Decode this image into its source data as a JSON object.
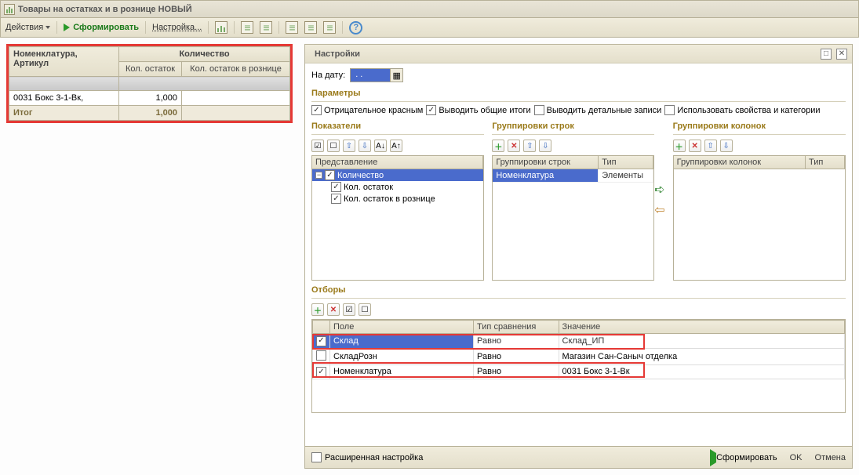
{
  "window": {
    "title": "Товары на остатках и в рознице НОВЫЙ"
  },
  "toolbar": {
    "actions": "Действия",
    "generate": "Сформировать",
    "settings": "Настройка..."
  },
  "grid": {
    "header_nomenclature": "Номенклатура, Артикул",
    "header_qty": "Количество",
    "header_balance": "Кол. остаток",
    "header_retail": "Кол. остаток в рознице",
    "rows": [
      {
        "name": "0031 Бокс 3-1-Вк,",
        "balance": "1,000"
      }
    ],
    "total_label": "Итог",
    "total_balance": "1,000"
  },
  "settings": {
    "title": "Настройки",
    "date_label": "На дату:",
    "params_label": "Параметры",
    "checks": {
      "neg_red": "Отрицательное красным",
      "totals": "Выводить общие итоги",
      "details": "Выводить детальные записи",
      "props": "Использовать свойства и категории"
    },
    "indicators": {
      "label": "Показатели",
      "col": "Представление",
      "items": [
        "Количество",
        "Кол. остаток",
        "Кол. остаток в рознице"
      ]
    },
    "row_groups": {
      "label": "Группировки строк",
      "col": "Группировки строк",
      "col2": "Тип",
      "item": "Номенклатура",
      "type": "Элементы"
    },
    "col_groups": {
      "label": "Группировки колонок",
      "col": "Группировки колонок",
      "col2": "Тип"
    },
    "filters": {
      "label": "Отборы",
      "col_field": "Поле",
      "col_cmp": "Тип сравнения",
      "col_val": "Значение",
      "rows": [
        {
          "checked": true,
          "field": "Склад",
          "cmp": "Равно",
          "val": "Склад_ИП",
          "selected": true
        },
        {
          "checked": false,
          "field": "СкладРозн",
          "cmp": "Равно",
          "val": "Магазин Сан-Саныч отделка"
        },
        {
          "checked": true,
          "field": "Номенклатура",
          "cmp": "Равно",
          "val": "0031 Бокс 3-1-Вк"
        }
      ]
    },
    "footer": {
      "advanced": "Расширенная настройка",
      "generate": "Сформировать",
      "ok": "OK",
      "cancel": "Отмена"
    }
  }
}
